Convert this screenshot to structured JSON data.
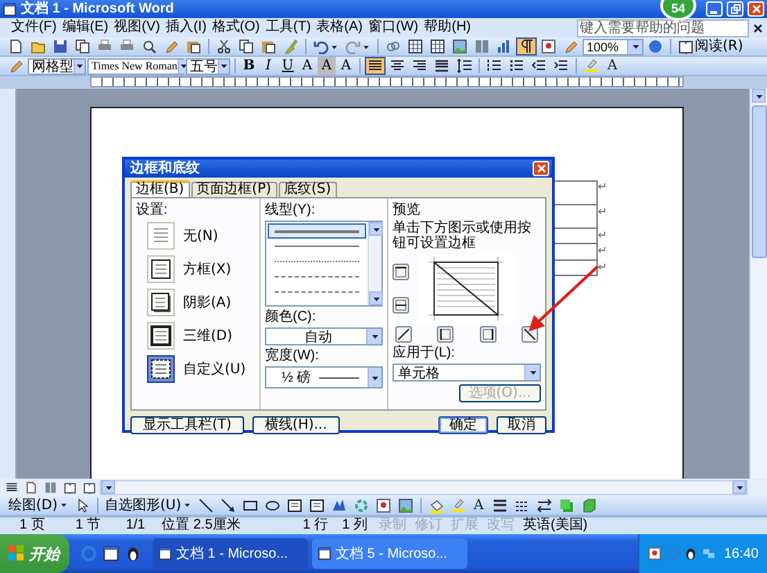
{
  "window": {
    "title": "文档 1 - Microsoft Word",
    "badge": "54"
  },
  "menu": {
    "items": [
      "文件(F)",
      "编辑(E)",
      "视图(V)",
      "插入(I)",
      "格式(O)",
      "工具(T)",
      "表格(A)",
      "窗口(W)",
      "帮助(H)"
    ],
    "help_placeholder": "键入需要帮助的问题"
  },
  "standard_toolbar": {
    "formatting_marks_on": true,
    "zoom": "100%",
    "read": "阅读(R)"
  },
  "format_toolbar": {
    "style": "网格型",
    "font": "Times New Roman",
    "size": "五号",
    "letter_buttons": [
      "B",
      "I",
      "U",
      "A",
      "A",
      "A"
    ],
    "alignments": [
      {
        "kind": "justify",
        "selected": true
      },
      {
        "kind": "center",
        "selected": false
      },
      {
        "kind": "right",
        "selected": false
      },
      {
        "kind": "distributed",
        "selected": false
      }
    ],
    "font_color": "A"
  },
  "table": {
    "rows": [
      {
        "mark": "↵"
      },
      {
        "mark": "↵"
      },
      {
        "mark": "↵"
      },
      {
        "mark": "↵"
      },
      {
        "mark": "↵"
      }
    ]
  },
  "dialog": {
    "title": "边框和底纹",
    "tabs": [
      {
        "label": "边框(B)",
        "selected": true
      },
      {
        "label": "页面边框(P)",
        "selected": false
      },
      {
        "label": "底纹(S)",
        "selected": false
      }
    ],
    "setting_label": "设置:",
    "settings": [
      {
        "label": "无(N)",
        "kind": "none",
        "selected": false
      },
      {
        "label": "方框(X)",
        "kind": "box",
        "selected": false
      },
      {
        "label": "阴影(A)",
        "kind": "shadow",
        "selected": false
      },
      {
        "label": "三维(D)",
        "kind": "threed",
        "selected": false
      },
      {
        "label": "自定义(U)",
        "kind": "custom",
        "selected": true
      }
    ],
    "style_label": "线型(Y):",
    "line_styles": [
      {
        "kind": "solid",
        "selected": true
      },
      {
        "kind": "solid",
        "selected": false
      },
      {
        "kind": "dotted",
        "selected": false
      },
      {
        "kind": "dashed",
        "selected": false
      },
      {
        "kind": "dashdot",
        "selected": false
      }
    ],
    "color_label": "颜色(C):",
    "color_value": "自动",
    "width_label": "宽度(W):",
    "width_value": "½ 磅",
    "preview_label": "预览",
    "preview_hint": "单击下方图示或使用按钮可设置边框",
    "preview_diagonal": true,
    "apply_label": "应用于(L):",
    "apply_value": "单元格",
    "options_button": {
      "label": "选项(O)...",
      "disabled": true
    },
    "buttons": [
      {
        "label": "显示工具栏(T)",
        "default": false
      },
      {
        "label": "横线(H)...",
        "default": false
      },
      {
        "label": "确定",
        "default": true
      },
      {
        "label": "取消",
        "default": false
      }
    ]
  },
  "drawing_toolbar": {
    "draw": "绘图(D)",
    "autoshapes": "自选图形(U)",
    "font_color": "A"
  },
  "status_bar": {
    "items": [
      {
        "text": "1 页",
        "disabled": false
      },
      {
        "text": "1 节",
        "disabled": false
      },
      {
        "text": "1/1",
        "disabled": false
      },
      {
        "text": "位置 2.5厘米",
        "disabled": false
      },
      {
        "text": "1 行",
        "disabled": false
      },
      {
        "text": "1 列",
        "disabled": false
      },
      {
        "text": "录制",
        "disabled": true
      },
      {
        "text": "修订",
        "disabled": true
      },
      {
        "text": "扩展",
        "disabled": true
      },
      {
        "text": "改写",
        "disabled": true
      },
      {
        "text": "英语(美国)",
        "disabled": false
      }
    ]
  },
  "taskbar": {
    "start": "开始",
    "tasks": [
      {
        "label": "文档 1 - Microso...",
        "selected": true
      },
      {
        "label": "文档 5 - Microso...",
        "selected": false
      }
    ],
    "clock": "16:40"
  }
}
